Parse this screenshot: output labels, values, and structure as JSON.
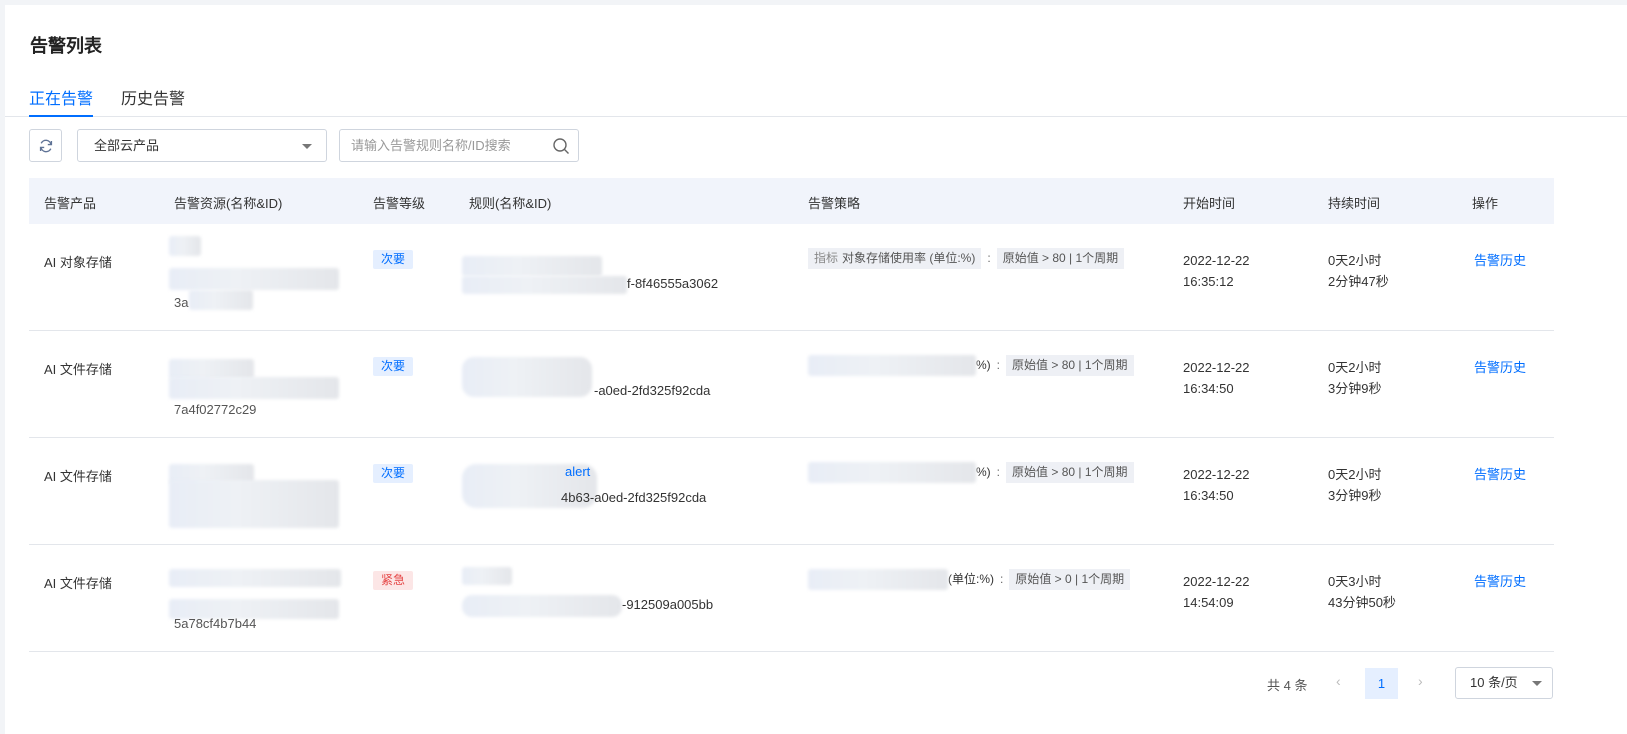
{
  "title": "告警列表",
  "tabs": [
    {
      "label": "正在告警",
      "active": true
    },
    {
      "label": "历史告警",
      "active": false
    }
  ],
  "toolbar": {
    "product_select": "全部云产品",
    "search_placeholder": "请输入告警规则名称/ID搜索"
  },
  "table": {
    "columns": [
      "告警产品",
      "告警资源(名称&ID)",
      "告警等级",
      "规则(名称&ID)",
      "告警策略",
      "开始时间",
      "持续时间",
      "操作"
    ],
    "rows": [
      {
        "product": "AI 对象存储",
        "resource_tail": "3a",
        "level": "次要",
        "level_type": "minor",
        "rule_link": "",
        "rule_tail": "f-8f46555a3062",
        "metric_key": "指标",
        "metric_name": "对象存储使用率 (单位:%)",
        "metric_sep": ":",
        "condition": "原始值 > 80 | 1个周期",
        "start_date": "2022-12-22",
        "start_time": "16:35:12",
        "duration_1": "0天2小时",
        "duration_2": "2分钟47秒",
        "action": "告警历史"
      },
      {
        "product": "AI 文件存储",
        "resource_tail": "7a4f02772c29",
        "level": "次要",
        "level_type": "minor",
        "rule_link": "",
        "rule_tail": "-a0ed-2fd325f92cda",
        "metric_key": "",
        "metric_name": "%)",
        "metric_sep": ":",
        "condition": "原始值 > 80 | 1个周期",
        "start_date": "2022-12-22",
        "start_time": "16:34:50",
        "duration_1": "0天2小时",
        "duration_2": "3分钟9秒",
        "action": "告警历史"
      },
      {
        "product": "AI 文件存储",
        "resource_tail": "",
        "level": "次要",
        "level_type": "minor",
        "rule_link": "alert",
        "rule_tail": "4b63-a0ed-2fd325f92cda",
        "metric_key": "",
        "metric_name": "%)",
        "metric_sep": ":",
        "condition": "原始值 > 80 | 1个周期",
        "start_date": "2022-12-22",
        "start_time": "16:34:50",
        "duration_1": "0天2小时",
        "duration_2": "3分钟9秒",
        "action": "告警历史"
      },
      {
        "product": "AI 文件存储",
        "resource_tail": "5a78cf4b7b44",
        "level": "紧急",
        "level_type": "urgent",
        "rule_link": "",
        "rule_tail": "-912509a005bb",
        "metric_key": "",
        "metric_name": "(单位:%)",
        "metric_sep": ":",
        "condition": "原始值 > 0 | 1个周期",
        "start_date": "2022-12-22",
        "start_time": "14:54:09",
        "duration_1": "0天3小时",
        "duration_2": "43分钟50秒",
        "action": "告警历史"
      }
    ]
  },
  "pagination": {
    "total": "共 4 条",
    "current": "1",
    "prev": "‹",
    "next": "›",
    "page_size": "10 条/页"
  },
  "colors": {
    "accent": "#006eff",
    "urgent": "#e54545"
  }
}
